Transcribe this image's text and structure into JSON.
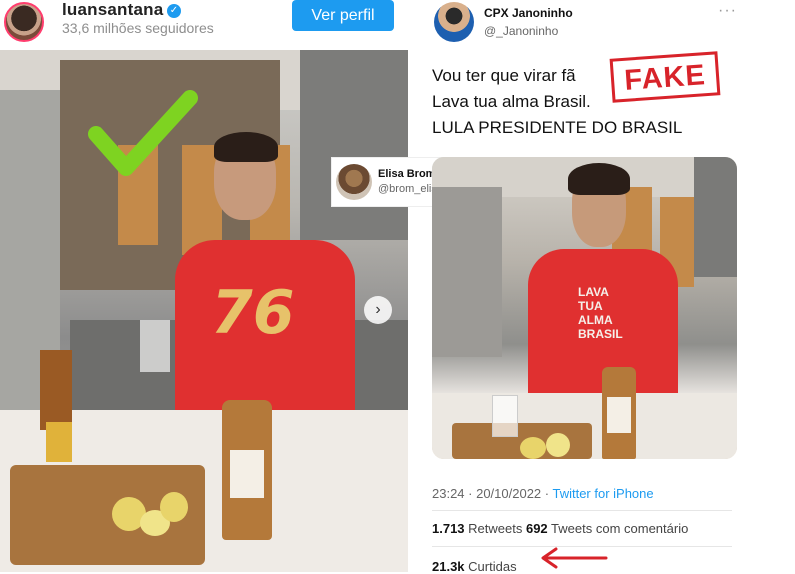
{
  "instagram": {
    "username": "luansantana",
    "verified_badge": "✓",
    "followers": "33,6 milhões seguidores",
    "view_profile_label": "Ver perfil",
    "next_icon": "chevron-right-icon"
  },
  "left_photo": {
    "shirt_number": "76",
    "overlay_icon": "check-mark-icon",
    "overlay_color": "#7ed321"
  },
  "elisa_card": {
    "name": "Elisa Brom",
    "handle": "@brom_elisa"
  },
  "tweet": {
    "author_name": "CPX Janoninho",
    "author_handle": "@_Janoninho",
    "more_icon": "···",
    "lines": [
      "Vou ter que virar fã",
      "Lava tua alma Brasil.",
      "LULA PRESIDENTE DO BRASIL"
    ],
    "fake_stamp": "FAKE",
    "shirt_text": [
      "LAVA",
      "TUA",
      "ALMA",
      "BRASIL"
    ],
    "timestamp": "23:24 · 20/10/2022 · ",
    "source": "Twitter for iPhone",
    "retweets_count": "1.713",
    "retweets_label": " Retweets ",
    "quotes_count": "692",
    "quotes_label": " Tweets com comentário",
    "likes_count": "21.3k",
    "likes_label": " Curtidas",
    "arrow_color": "#d8232a"
  }
}
